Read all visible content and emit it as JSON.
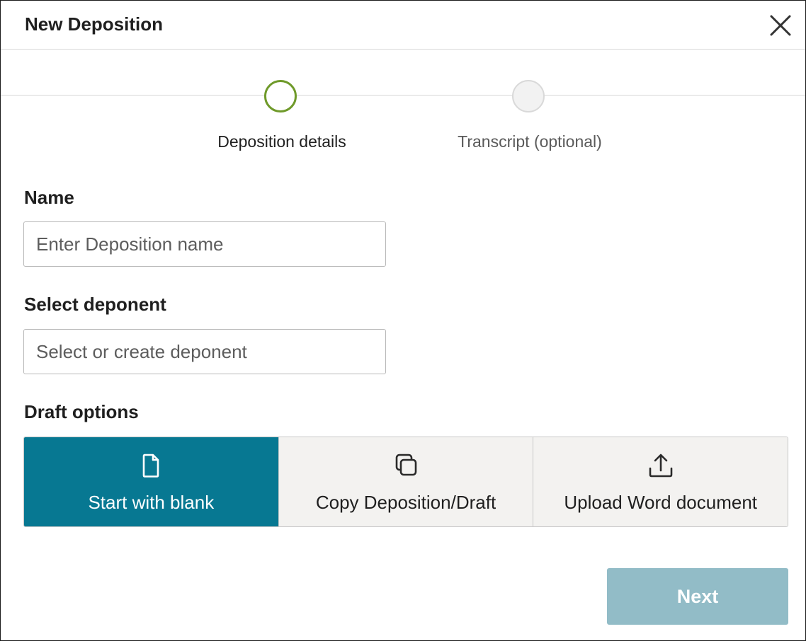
{
  "dialog": {
    "title": "New Deposition",
    "close_icon": "close-icon"
  },
  "stepper": {
    "steps": [
      {
        "label": "Deposition details",
        "state": "active"
      },
      {
        "label": "Transcript (optional)",
        "state": "inactive"
      }
    ]
  },
  "form": {
    "name": {
      "label": "Name",
      "placeholder": "Enter Deposition name",
      "value": ""
    },
    "deponent": {
      "label": "Select deponent",
      "placeholder": "Select or create deponent",
      "value": ""
    },
    "draft_options": {
      "label": "Draft options",
      "options": [
        {
          "label": "Start with blank",
          "icon": "file-icon",
          "selected": true
        },
        {
          "label": "Copy Deposition/Draft",
          "icon": "copy-icon",
          "selected": false
        },
        {
          "label": "Upload Word document",
          "icon": "upload-icon",
          "selected": false
        }
      ]
    }
  },
  "footer": {
    "next_label": "Next"
  },
  "colors": {
    "accent": "#077892",
    "step_active": "#6f9a2a",
    "next_disabled": "#92bcc7"
  }
}
